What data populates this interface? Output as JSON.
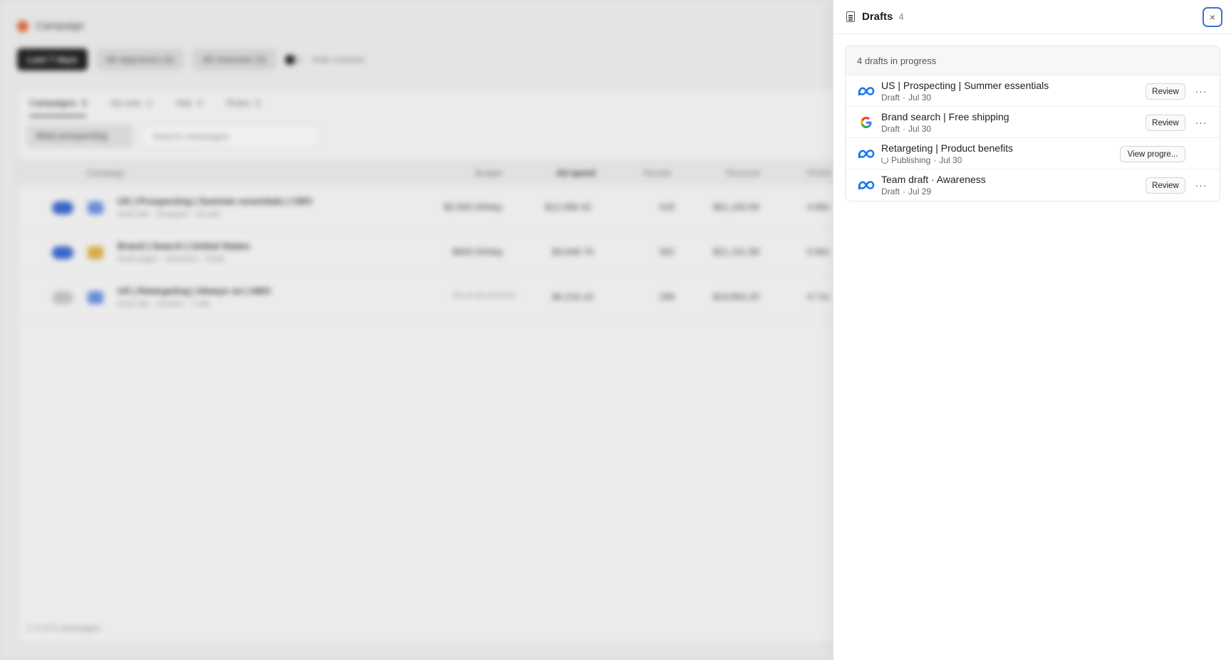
{
  "background": {
    "app_title": "Campaign",
    "filters": {
      "date_range": "Last 7 days",
      "objectives": "All objectives (3)",
      "channels": "All channels (3)",
      "hide_toggle_label": "Hide inactive"
    },
    "tabs": [
      {
        "label": "Campaigns",
        "count": "3"
      },
      {
        "label": "Ad sets",
        "count": "2"
      },
      {
        "label": "Ads",
        "count": "4"
      },
      {
        "label": "Rules",
        "count": "0"
      }
    ],
    "view_select": "Meta prospecting",
    "search_placeholder": "Search campaigns",
    "columns": {
      "campaign": "Campaign",
      "budget": "Budget",
      "ad_spend": "Ad spend",
      "results": "Results",
      "revenue": "Revenue",
      "roas": "ROAS"
    },
    "rows": [
      {
        "name": "US | Prospecting | Summer essentials | CBO",
        "sub": "Avail ads · Shoppers · All ads",
        "budget": "$2,000.00/day",
        "spend": "$12,486.42",
        "results": "418",
        "revenue": "$61,182.84",
        "roas": "4.89x"
      },
      {
        "name": "Brand | Search | United States",
        "sub": "Avail pages · Searches · Trade",
        "budget": "$800.00/day",
        "spend": "$3,648.76",
        "results": "302",
        "revenue": "$21,151.88",
        "roas": "5.80x"
      },
      {
        "name": "US | Retargeting | Always on | ABO",
        "sub": "Avail ads · Viewers · 7 ads",
        "budget": "Set at ad set level",
        "spend": "$4,216.16",
        "results": "188",
        "revenue": "$19,864.20",
        "roas": "4.71x"
      }
    ],
    "footer": "1-3 of 3 campaigns"
  },
  "panel": {
    "title": "Drafts",
    "count": "4",
    "close_icon": "×",
    "summary": "4 drafts in progress",
    "more_icon": "···",
    "drafts": [
      {
        "title": "US | Prospecting | Summer essentials",
        "status": "Draft",
        "sep": "·",
        "date": "Jul 30",
        "platform": "meta",
        "action": "Review"
      },
      {
        "title": "Brand search | Free shipping",
        "status": "Draft",
        "sep": "·",
        "date": "Jul 30",
        "platform": "google",
        "action": "Review"
      },
      {
        "title": "Retargeting | Product benefits",
        "status": "Publishing",
        "sep": "·",
        "date": "Jul 30",
        "platform": "meta",
        "action": "View progre..."
      },
      {
        "title": "Team draft · Awareness",
        "status": "Draft",
        "sep": "·",
        "date": "Jul 29",
        "platform": "meta",
        "action": "Review"
      }
    ]
  },
  "colors": {
    "meta_blue": "#1877f2",
    "focus_ring": "#3f6fd6",
    "google_red": "#ea4335",
    "google_yellow": "#fbbc05",
    "google_green": "#34a853",
    "google_blue": "#4285f4"
  }
}
